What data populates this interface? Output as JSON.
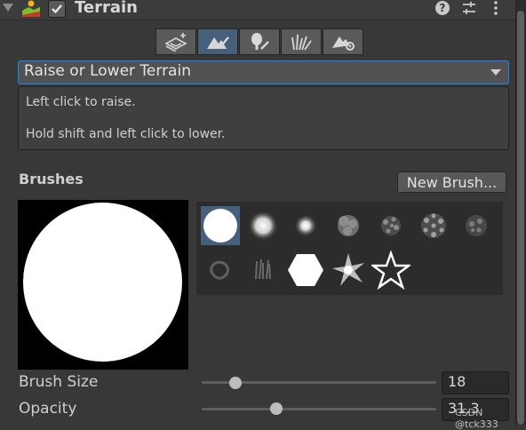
{
  "header": {
    "title": "Terrain",
    "enabled": true,
    "icons": [
      "foldout-arrow-icon",
      "terrain-component-icon",
      "help-icon",
      "presets-icon",
      "context-menu-icon"
    ]
  },
  "toolbar": {
    "tools": [
      {
        "name": "create-neighbor-terrains",
        "icon": "terrain-add-icon",
        "selected": false
      },
      {
        "name": "paint-terrain",
        "icon": "terrain-brush-icon",
        "selected": true
      },
      {
        "name": "paint-trees",
        "icon": "tree-brush-icon",
        "selected": false
      },
      {
        "name": "paint-details",
        "icon": "grass-brush-icon",
        "selected": false
      },
      {
        "name": "terrain-settings",
        "icon": "terrain-gear-icon",
        "selected": false
      }
    ]
  },
  "tool_dropdown": {
    "selected": "Raise or Lower Terrain"
  },
  "help": {
    "line1": "Left click to raise.",
    "line2": "Hold shift and left click to lower."
  },
  "brushes": {
    "label": "Brushes",
    "new_button": "New Brush...",
    "selected_index": 0,
    "items": [
      "hard-circle",
      "soft-circle",
      "small-soft-dot",
      "cloud-noise",
      "speckle-noise-1",
      "speckle-noise-2",
      "speckle-noise-3",
      "ring-smudge",
      "grass-strokes",
      "hexagon",
      "star-burst",
      "star-outline"
    ]
  },
  "settings": {
    "brush_size": {
      "label": "Brush Size",
      "value": "18",
      "slider_fraction": 0.145
    },
    "opacity": {
      "label": "Opacity",
      "value": "31.3",
      "slider_fraction": 0.32
    }
  },
  "watermark": "CSDN @tck333",
  "colors": {
    "selected": "#46607c",
    "focus": "#3a79bb",
    "background": "#383838"
  }
}
